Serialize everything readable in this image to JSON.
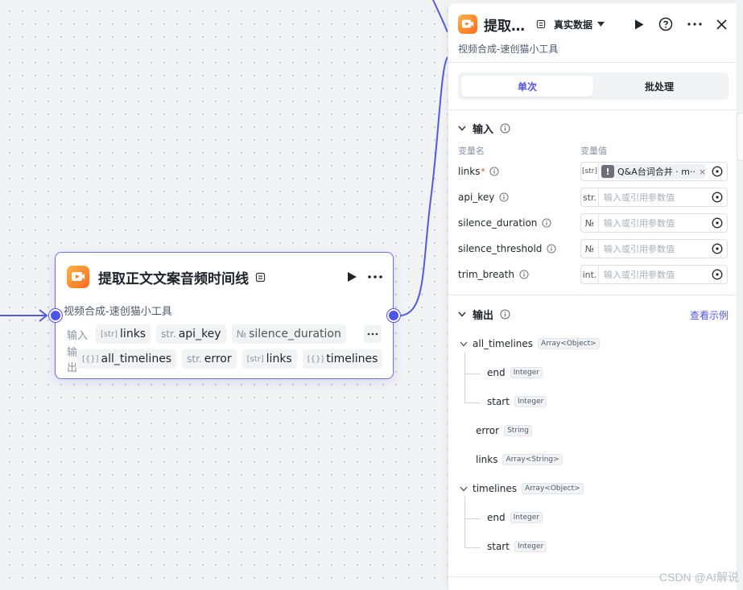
{
  "node": {
    "title": "提取正文文案音频时间线",
    "subtitle": "视频合成-速创猫小工具",
    "input_label": "输入",
    "output_label": "输出",
    "inputs": [
      {
        "type": "[str]",
        "name": "links"
      },
      {
        "type": "str.",
        "name": "api_key"
      },
      {
        "type": "№",
        "name": "silence_duration"
      }
    ],
    "outputs": [
      {
        "type": "[{}]",
        "name": "all_timelines"
      },
      {
        "type": "str.",
        "name": "error"
      },
      {
        "type": "[str]",
        "name": "links"
      },
      {
        "type": "[{}]",
        "name": "timelines"
      }
    ]
  },
  "panel": {
    "title": "提取…",
    "select_label": "真实数据",
    "subtitle": "视频合成-速创猫小工具",
    "tabs": [
      "单次",
      "批处理"
    ],
    "input_section": "输入",
    "col_name": "变量名",
    "col_value": "变量值",
    "variables": [
      {
        "name": "links",
        "required": "*",
        "type": "[str]",
        "ref": "Q&A台词合并 · m··"
      },
      {
        "name": "api_key",
        "type": "str.",
        "placeholder": "输入或引用参数值"
      },
      {
        "name": "silence_duration",
        "type": "№",
        "placeholder": "输入或引用参数值"
      },
      {
        "name": "silence_threshold",
        "type": "№",
        "placeholder": "输入或引用参数值"
      },
      {
        "name": "trim_breath",
        "type": "int.",
        "placeholder": "输入或引用参数值"
      }
    ],
    "output_section": "输出",
    "output_link": "查看示例",
    "outputs": [
      {
        "name": "all_timelines",
        "type": "Array<Object>"
      },
      {
        "name": "end",
        "type": "Integer"
      },
      {
        "name": "start",
        "type": "Integer"
      },
      {
        "name": "error",
        "type": "String"
      },
      {
        "name": "links",
        "type": "Array<String>"
      },
      {
        "name": "timelines",
        "type": "Array<Object>"
      },
      {
        "name": "end",
        "type": "Integer"
      },
      {
        "name": "start",
        "type": "Integer"
      }
    ]
  },
  "watermark": "CSDN @AI解说",
  "colors": {
    "accent": "#4f54e8",
    "node_border": "#6c70e8",
    "icon_orange": "#ff7a1a"
  }
}
